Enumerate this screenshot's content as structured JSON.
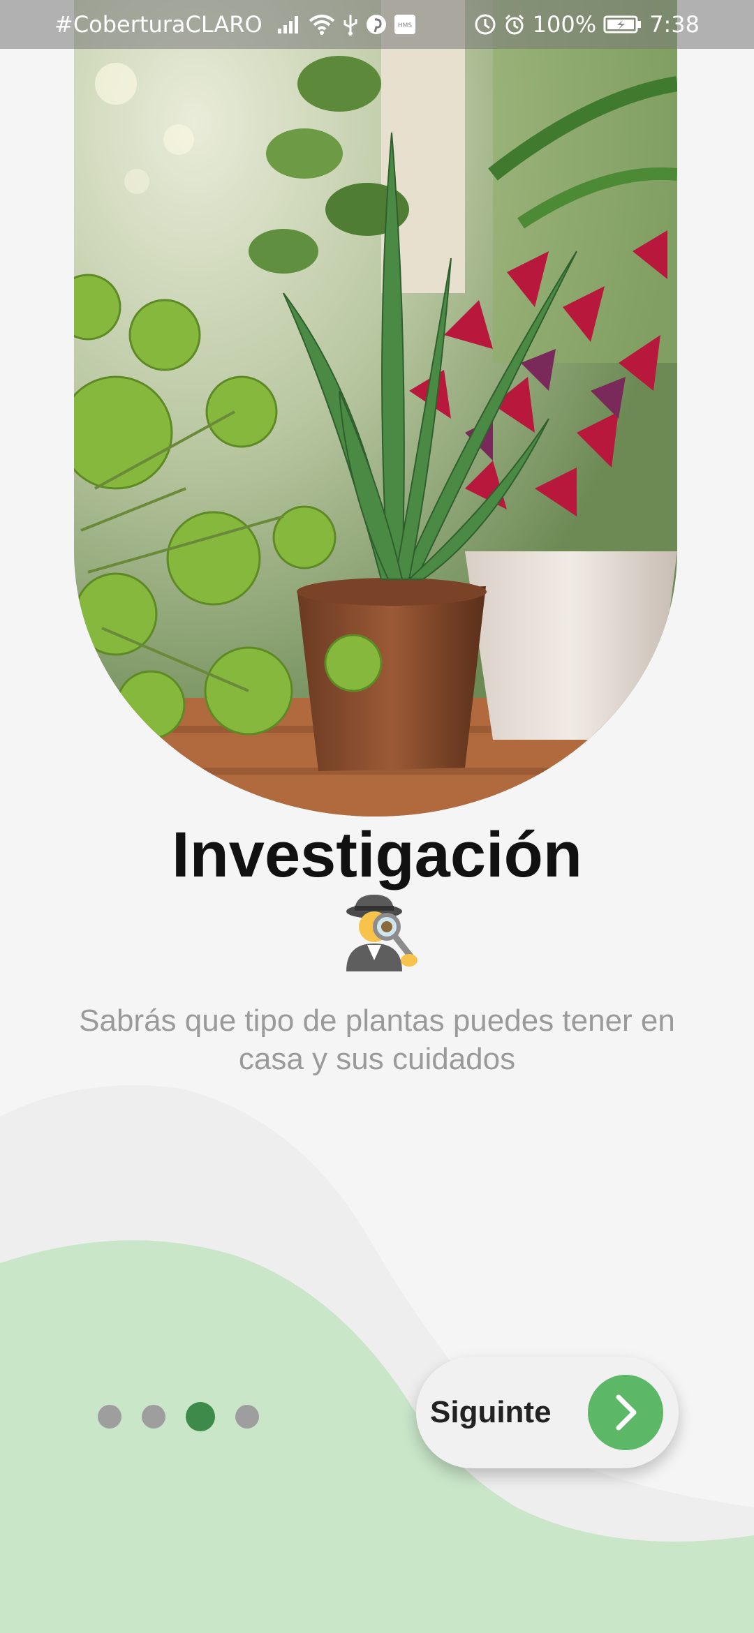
{
  "status_bar": {
    "carrier": "#CoberturaCLARO",
    "battery": "100%",
    "time": "7:38",
    "left_icons": [
      "signal-icon",
      "wifi-icon",
      "usb-icon",
      "pinterest-icon",
      "hms-icon"
    ],
    "right_icons": [
      "data-saver-icon",
      "alarm-icon",
      "battery-icon"
    ],
    "hms_badge": "HMS"
  },
  "onboarding": {
    "title": "Investigación",
    "emoji_icon": "detective-icon",
    "description": "Sabrás que tipo de plantas puedes tener en casa y sus cuidados",
    "hero_image": "houseplants-photo"
  },
  "pagination": {
    "total": 4,
    "current": 3
  },
  "next_button": {
    "label": "Siguinte",
    "icon": "chevron-right-icon"
  },
  "colors": {
    "background": "#f5f5f5",
    "wave_light": "#eeeeee",
    "wave_green": "#c9e6c9",
    "accent": "#5cb866",
    "dot_active": "#3e8a4a",
    "dot_inactive": "#9e9e9e",
    "title": "#111111",
    "subtitle": "#9a9a9a"
  }
}
